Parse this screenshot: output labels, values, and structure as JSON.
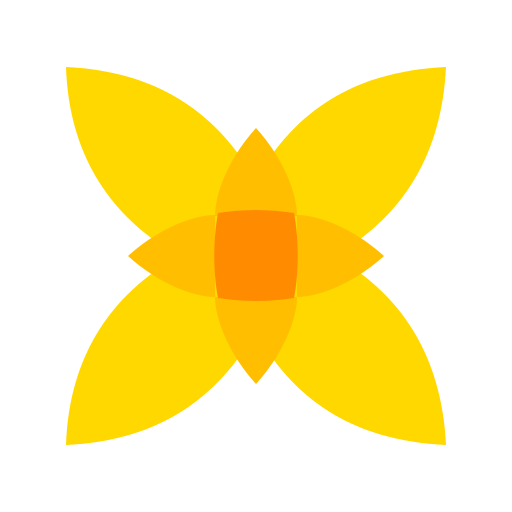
{
  "image": {
    "subject": "petal-logo",
    "background_color": "#FFFFFF"
  },
  "logo": {
    "icon": "four-petal-flower-icon",
    "colors": {
      "petal": "#FFD800",
      "petal_overlap": "#FFBF00",
      "center": "#FF8C00"
    }
  }
}
